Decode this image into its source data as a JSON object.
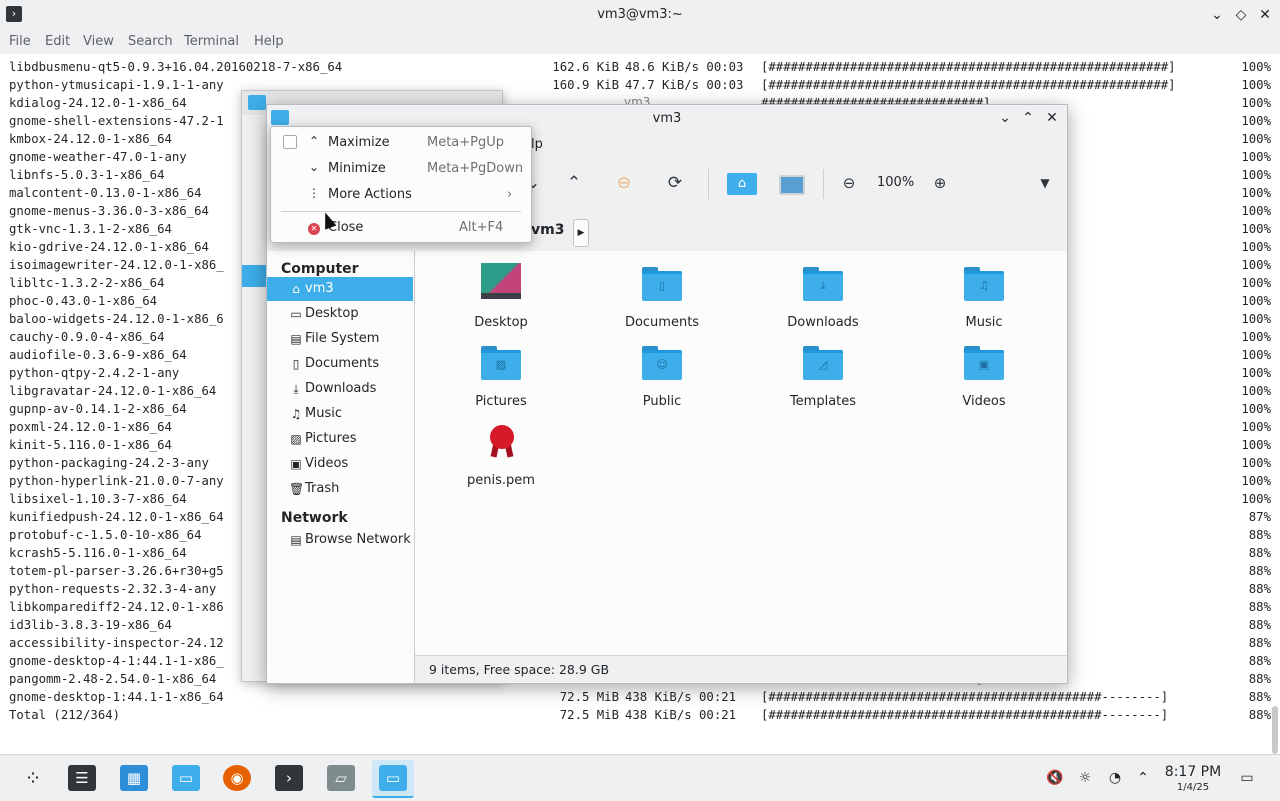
{
  "terminal": {
    "title": "vm3@vm3:~",
    "menu": [
      "File",
      "Edit",
      "View",
      "Search",
      "Terminal",
      "Help"
    ],
    "lines": [
      {
        "pkg": "libdbusmenu-qt5-0.9.3+16.04.20160218-7-x86_64",
        "size": "162.6 KiB",
        "rate": "48.6 KiB/s 00:03",
        "bar": "[######################################################]",
        "pct": "100%"
      },
      {
        "pkg": "python-ytmusicapi-1.9.1-1-any",
        "size": "160.9 KiB",
        "rate": "47.7 KiB/s 00:03",
        "bar": "[######################################################]",
        "pct": "100%"
      },
      {
        "pkg": "kdialog-24.12.0-1-x86_64",
        "size": "",
        "rate": "",
        "bar": "##############################]",
        "pct": "100%"
      },
      {
        "pkg": "gnome-shell-extensions-47.2-1",
        "size": "",
        "rate": "",
        "bar": "##############################]",
        "pct": "100%"
      },
      {
        "pkg": "kmbox-24.12.0-1-x86_64",
        "size": "",
        "rate": "",
        "bar": "##############################]",
        "pct": "100%"
      },
      {
        "pkg": "gnome-weather-47.0-1-any",
        "size": "",
        "rate": "",
        "bar": "##############################]",
        "pct": "100%"
      },
      {
        "pkg": "libnfs-5.0.3-1-x86_64",
        "size": "",
        "rate": "",
        "bar": "##############################]",
        "pct": "100%"
      },
      {
        "pkg": "malcontent-0.13.0-1-x86_64",
        "size": "",
        "rate": "",
        "bar": "##############################]",
        "pct": "100%"
      },
      {
        "pkg": "gnome-menus-3.36.0-3-x86_64",
        "size": "",
        "rate": "",
        "bar": "##############################]",
        "pct": "100%"
      },
      {
        "pkg": "gtk-vnc-1.3.1-2-x86_64",
        "size": "",
        "rate": "",
        "bar": "##############################]",
        "pct": "100%"
      },
      {
        "pkg": "kio-gdrive-24.12.0-1-x86_64",
        "size": "",
        "rate": "",
        "bar": "##############################]",
        "pct": "100%"
      },
      {
        "pkg": "isoimagewriter-24.12.0-1-x86_",
        "size": "",
        "rate": "",
        "bar": "##############################]",
        "pct": "100%"
      },
      {
        "pkg": "libltc-1.3.2-2-x86_64",
        "size": "",
        "rate": "",
        "bar": "##############################]",
        "pct": "100%"
      },
      {
        "pkg": "phoc-0.43.0-1-x86_64",
        "size": "",
        "rate": "",
        "bar": "##############################]",
        "pct": "100%"
      },
      {
        "pkg": "baloo-widgets-24.12.0-1-x86_6",
        "size": "",
        "rate": "",
        "bar": "##############################]",
        "pct": "100%"
      },
      {
        "pkg": "cauchy-0.9.0-4-x86_64",
        "size": "",
        "rate": "",
        "bar": "##############################]",
        "pct": "100%"
      },
      {
        "pkg": "audiofile-0.3.6-9-x86_64",
        "size": "",
        "rate": "",
        "bar": "##############################]",
        "pct": "100%"
      },
      {
        "pkg": "python-qtpy-2.4.2-1-any",
        "size": "",
        "rate": "",
        "bar": "##############################]",
        "pct": "100%"
      },
      {
        "pkg": "libgravatar-24.12.0-1-x86_64",
        "size": "",
        "rate": "",
        "bar": "##############################]",
        "pct": "100%"
      },
      {
        "pkg": "gupnp-av-0.14.1-2-x86_64",
        "size": "",
        "rate": "",
        "bar": "##############################]",
        "pct": "100%"
      },
      {
        "pkg": "poxml-24.12.0-1-x86_64",
        "size": "",
        "rate": "",
        "bar": "##############################]",
        "pct": "100%"
      },
      {
        "pkg": "kinit-5.116.0-1-x86_64",
        "size": "",
        "rate": "",
        "bar": "##############################]",
        "pct": "100%"
      },
      {
        "pkg": "python-packaging-24.2-3-any",
        "size": "",
        "rate": "",
        "bar": "##############################]",
        "pct": "100%"
      },
      {
        "pkg": "python-hyperlink-21.0.0-7-any",
        "size": "",
        "rate": "",
        "bar": "##############################]",
        "pct": "100%"
      },
      {
        "pkg": "libsixel-1.10.3-7-x86_64",
        "size": "",
        "rate": "",
        "bar": "##############################]",
        "pct": "100%"
      },
      {
        "pkg": "kunifiedpush-24.12.0-1-x86_64",
        "size": "",
        "rate": "",
        "bar": "######################-------]",
        "pct": "87%"
      },
      {
        "pkg": "protobuf-c-1.5.0-10-x86_64",
        "size": "",
        "rate": "",
        "bar": "######################-------]",
        "pct": "88%"
      },
      {
        "pkg": "kcrash5-5.116.0-1-x86_64",
        "size": "",
        "rate": "",
        "bar": "######################-------]",
        "pct": "88%"
      },
      {
        "pkg": "totem-pl-parser-3.26.6+r30+g5",
        "size": "",
        "rate": "",
        "bar": "######################-------]",
        "pct": "88%"
      },
      {
        "pkg": "python-requests-2.32.3-4-any",
        "size": "",
        "rate": "",
        "bar": "######################-------]",
        "pct": "88%"
      },
      {
        "pkg": "libkomparediff2-24.12.0-1-x86",
        "size": "",
        "rate": "",
        "bar": "######################-------]",
        "pct": "88%"
      },
      {
        "pkg": "id3lib-3.8.3-19-x86_64",
        "size": "",
        "rate": "",
        "bar": "######################-------]",
        "pct": "88%"
      },
      {
        "pkg": "accessibility-inspector-24.12",
        "size": "",
        "rate": "",
        "bar": "######################-------]",
        "pct": "88%"
      },
      {
        "pkg": "gnome-desktop-4-1:44.1-1-x86_",
        "size": "",
        "rate": "",
        "bar": "######################-------]",
        "pct": "88%"
      },
      {
        "pkg": "pangomm-2.48-2.54.0-1-x86_64",
        "size": "",
        "rate": "",
        "bar": "######################-------]",
        "pct": "88%"
      },
      {
        "pkg": "gnome-desktop-1:44.1-1-x86_64",
        "size": "72.5 MiB",
        "rate": "438 KiB/s 00:21",
        "bar": "[#############################################--------]",
        "pct": "88%"
      },
      {
        "pkg": "Total (212/364)",
        "size": "72.5 MiB",
        "rate": "438 KiB/s 00:21",
        "bar": "[#############################################--------]",
        "pct": "88%"
      }
    ]
  },
  "dolphin": {
    "title": "vm3",
    "bg_title": "vm3",
    "menu_partial": "lp",
    "zoom": "100%",
    "breadcrumb": "vm3",
    "places": {
      "computer_header": "Computer",
      "items": [
        {
          "label": "vm3",
          "icon": "home-icon",
          "glyph": "⌂",
          "selected": true
        },
        {
          "label": "Desktop",
          "icon": "desktop-icon",
          "glyph": "▭"
        },
        {
          "label": "File System",
          "icon": "drive-icon",
          "glyph": "▤"
        },
        {
          "label": "Documents",
          "icon": "documents-icon",
          "glyph": "▯"
        },
        {
          "label": "Downloads",
          "icon": "download-icon",
          "glyph": "⤓"
        },
        {
          "label": "Music",
          "icon": "music-icon",
          "glyph": "♫"
        },
        {
          "label": "Pictures",
          "icon": "pictures-icon",
          "glyph": "▨"
        },
        {
          "label": "Videos",
          "icon": "videos-icon",
          "glyph": "▣"
        },
        {
          "label": "Trash",
          "icon": "trash-icon",
          "glyph": "🗑"
        }
      ],
      "network_header": "Network",
      "network_items": [
        {
          "label": "Browse Network",
          "icon": "network-icon",
          "glyph": "▤"
        }
      ]
    },
    "files": [
      {
        "name": "Desktop",
        "kind": "desktop"
      },
      {
        "name": "Documents",
        "kind": "folder",
        "glyph": "▯"
      },
      {
        "name": "Downloads",
        "kind": "folder",
        "glyph": "⤓"
      },
      {
        "name": "Music",
        "kind": "folder",
        "glyph": "♫"
      },
      {
        "name": "Pictures",
        "kind": "folder",
        "glyph": "▨"
      },
      {
        "name": "Public",
        "kind": "folder",
        "glyph": "☺"
      },
      {
        "name": "Templates",
        "kind": "folder",
        "glyph": "◿"
      },
      {
        "name": "Videos",
        "kind": "folder",
        "glyph": "▣"
      },
      {
        "name": "penis.pem",
        "kind": "pem"
      }
    ],
    "status": "9 items, Free space: 28.9 GB"
  },
  "context_menu": {
    "items": [
      {
        "label": "Maximize",
        "shortcut": "Meta+PgUp",
        "icon": "chevron-up-icon",
        "glyph": "⌃"
      },
      {
        "label": "Minimize",
        "shortcut": "Meta+PgDown",
        "icon": "chevron-down-icon",
        "glyph": "⌄"
      },
      {
        "label": "More Actions",
        "shortcut": "",
        "icon": "more-icon",
        "glyph": "⋮"
      }
    ],
    "close_label": "Close",
    "close_shortcut": "Alt+F4"
  },
  "taskbar": {
    "time": "8:17 PM",
    "date": "1/4/25"
  },
  "colors": {
    "accent": "#3daee9",
    "close": "#da4453"
  }
}
